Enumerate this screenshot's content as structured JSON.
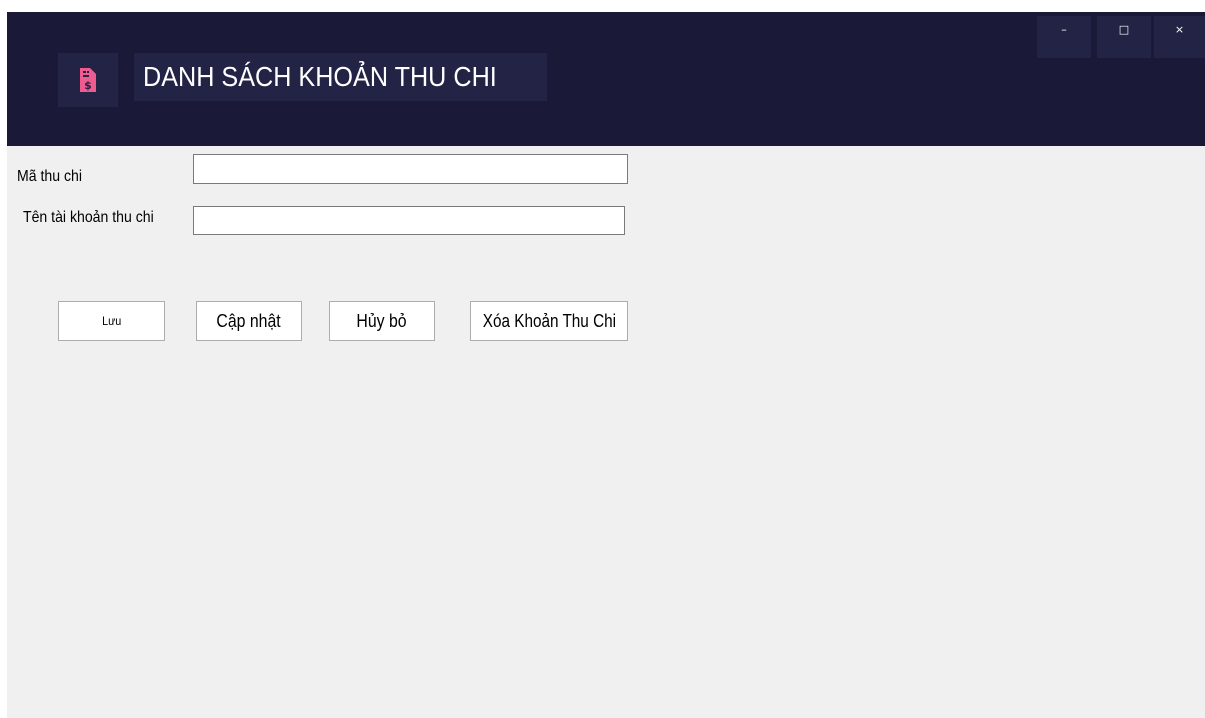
{
  "window": {
    "title": "DANH SÁCH KHOẢN THU CHI",
    "controls": {
      "minimize": "–",
      "maximize": "□",
      "close": "×"
    },
    "logo_icon": "receipt-dollar-icon",
    "colors": {
      "header_bg": "#1a1a38",
      "header_box_bg": "#232346",
      "logo_accent": "#ee5b8f",
      "body_bg": "#f0f0f0"
    }
  },
  "form": {
    "ma_thu_chi": {
      "label": "Mã thu chi",
      "value": ""
    },
    "ten_tai_khoan": {
      "label": "Tên tài khoản thu chi",
      "value": ""
    }
  },
  "buttons": {
    "save": "Lưu",
    "update": "Cập nhật",
    "cancel": "Hủy bỏ",
    "delete": "Xóa Khoản Thu Chi"
  }
}
